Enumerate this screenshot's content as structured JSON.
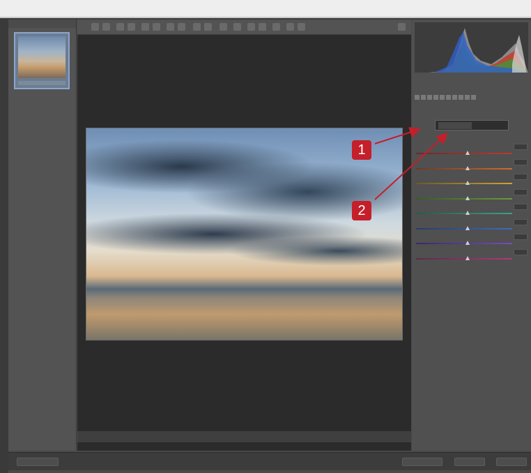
{
  "callouts": [
    "1",
    "2"
  ],
  "colors": {
    "callout": "#c51f2a",
    "sliders": [
      "#c0392b",
      "#d46a2a",
      "#cfa530",
      "#6a9a3a",
      "#3aa08a",
      "#3a6ec0",
      "#7a4ac0",
      "#b03a7a"
    ]
  },
  "icons": [
    "zoom-tool-icon",
    "hand-tool-icon",
    "white-balance-tool-icon",
    "color-sampler-icon",
    "crop-tool-icon",
    "straighten-tool-icon",
    "spot-removal-icon",
    "red-eye-icon",
    "adjustment-brush-icon",
    "graduated-filter-icon",
    "preferences-icon",
    "rotate-left-icon",
    "rotate-right-icon",
    "fullscreen-icon"
  ]
}
